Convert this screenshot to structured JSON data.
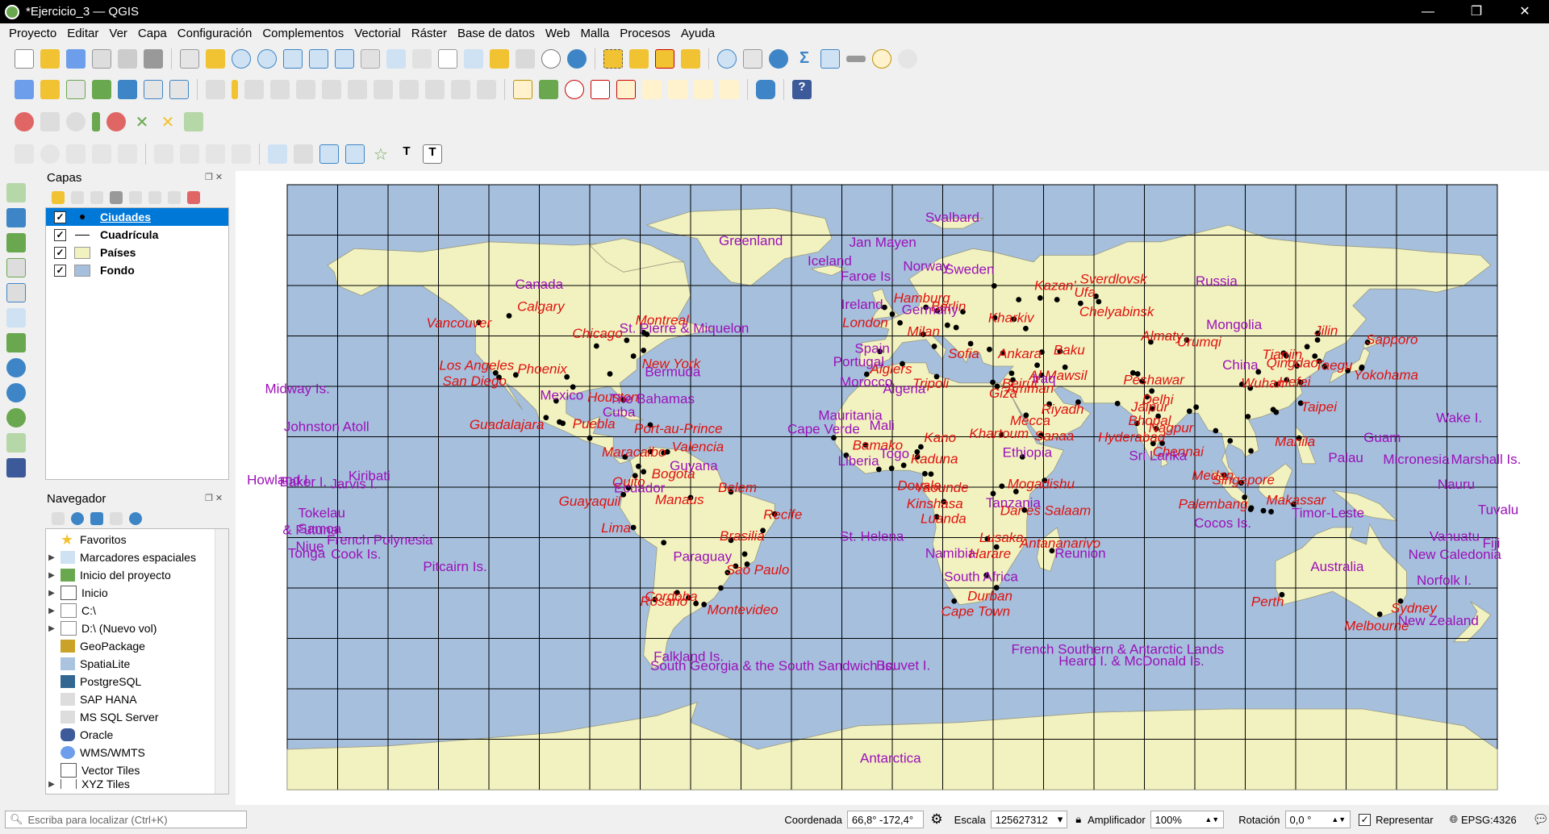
{
  "window": {
    "title": "*Ejercicio_3 — QGIS",
    "controls": [
      "—",
      "❐",
      "✕"
    ]
  },
  "menu": [
    "Proyecto",
    "Editar",
    "Ver",
    "Capa",
    "Configuración",
    "Complementos",
    "Vectorial",
    "Ráster",
    "Base de datos",
    "Web",
    "Malla",
    "Procesos",
    "Ayuda"
  ],
  "layers_panel": {
    "title": "Capas",
    "layers": [
      {
        "name": "Ciudades",
        "checked": true,
        "symbol": "point-icon",
        "selected": true
      },
      {
        "name": "Cuadrícula",
        "checked": true,
        "symbol": "line-icon",
        "selected": false
      },
      {
        "name": "Países",
        "checked": true,
        "symbol": "fill-yellow-icon",
        "selected": false
      },
      {
        "name": "Fondo",
        "checked": true,
        "symbol": "fill-blue-icon",
        "selected": false
      }
    ]
  },
  "browser_panel": {
    "title": "Navegador",
    "items": [
      {
        "label": "Favoritos",
        "icon": "star-icon",
        "expandable": false
      },
      {
        "label": "Marcadores espaciales",
        "icon": "bookmark-icon",
        "expandable": true
      },
      {
        "label": "Inicio del proyecto",
        "icon": "project-home-icon",
        "expandable": true
      },
      {
        "label": "Inicio",
        "icon": "home-icon",
        "expandable": true
      },
      {
        "label": "C:\\",
        "icon": "folder-icon",
        "expandable": true
      },
      {
        "label": "D:\\ (Nuevo vol)",
        "icon": "folder-icon",
        "expandable": true
      },
      {
        "label": "GeoPackage",
        "icon": "geopackage-icon",
        "expandable": false
      },
      {
        "label": "SpatiaLite",
        "icon": "spatialite-icon",
        "expandable": false
      },
      {
        "label": "PostgreSQL",
        "icon": "postgresql-icon",
        "expandable": false
      },
      {
        "label": "SAP HANA",
        "icon": "sap-hana-icon",
        "expandable": false
      },
      {
        "label": "MS SQL Server",
        "icon": "mssql-icon",
        "expandable": false
      },
      {
        "label": "Oracle",
        "icon": "oracle-icon",
        "expandable": false
      },
      {
        "label": "WMS/WMTS",
        "icon": "wms-icon",
        "expandable": false
      },
      {
        "label": "Vector Tiles",
        "icon": "vector-tiles-icon",
        "expandable": false
      },
      {
        "label": "XYZ Tiles",
        "icon": "xyz-tiles-icon",
        "expandable": true
      }
    ]
  },
  "map": {
    "colors": {
      "ocean": "#a5bfdd",
      "land": "#f2f2c0",
      "grid": "#000000",
      "city_label": "#e0110d",
      "country_label": "#9c10b8"
    },
    "city_labels": [
      "Calgary",
      "Vancouver",
      "Chicago",
      "Montreal",
      "Los Angeles",
      "Phoenix",
      "New York",
      "San Diego",
      "Houston",
      "Puebla",
      "Guadalajara",
      "Port-au-Prince",
      "Maracaibo",
      "Valencia",
      "Bogota",
      "Quito",
      "Guayaquil",
      "Belem",
      "Manaus",
      "Recife",
      "Lima",
      "Brasilia",
      "Sao Paulo",
      "Cordoba",
      "Rosario",
      "Montevideo",
      "Hamburg",
      "Berlin",
      "London",
      "Milan",
      "Sofia",
      "Algiers",
      "Tripoli",
      "Kharkiv",
      "Kazan'",
      "Ufa",
      "Sverdlovsk",
      "Chelyabinsk",
      "Ankara",
      "Baku",
      "Beirut",
      "Al Mawsil",
      "Amman",
      "Giza",
      "Mecca",
      "Riyadh",
      "Almaty",
      "Urumqi",
      "Peshawar",
      "Delhi",
      "Jaipur",
      "Bhopal",
      "Nagpur",
      "Hyderabad",
      "Chennai",
      "Tianjin",
      "Jilin",
      "Qingdao",
      "Taegu",
      "Sapporo",
      "Yokohama",
      "Wuhan",
      "Hefei",
      "Taipei",
      "Manila",
      "Kano",
      "Kaduna",
      "Bamako",
      "Douala",
      "Yaounde",
      "Khartoum",
      "Sanaa",
      "Mogadishu",
      "Kinshasa",
      "Dar es Salaam",
      "Luanda",
      "Lusaka",
      "Antananarivo",
      "Harare",
      "Durban",
      "Cape Town",
      "Medan",
      "Singapore",
      "Palembang",
      "Makassar",
      "Perth",
      "Melbourne",
      "Sydney"
    ],
    "country_labels": [
      "Greenland",
      "Svalbard",
      "Jan Mayen",
      "Iceland",
      "Norway",
      "Sweden",
      "Faroe Is.",
      "Canada",
      "Ireland",
      "Germany",
      "Russia",
      "Mongolia",
      "China",
      "Spain",
      "Portugal",
      "St. Pierre & Miquelon",
      "Bermuda",
      "Morocco",
      "Algeria",
      "Iraq",
      "Mexico",
      "The Bahamas",
      "Cuba",
      "Mauritania",
      "Mali",
      "Cape Verde",
      "Togo",
      "Ethiopia",
      "Sri Lanka",
      "Liberia",
      "Guyana",
      "Ecuador",
      "Tanzania",
      "Namibia",
      "South Africa",
      "St. Helena",
      "Paraguay",
      "Midway Is.",
      "Johnston Atoll",
      "Howland I.",
      "Baker I.",
      "Kiribati",
      "Jarvis I.",
      "Tokelau",
      "Samoa",
      "French Polynesia",
      "& Futuna",
      "Tonga",
      "Niue",
      "Cook Is.",
      "Pitcairn Is.",
      "Reunion",
      "Cocos Is.",
      "Timor-Leste",
      "Guam",
      "Palau",
      "Micronesia",
      "Wake I.",
      "Marshall Is.",
      "Nauru",
      "Tuvalu",
      "Vanuatu",
      "Fiji",
      "New Caledonia",
      "Norfolk I.",
      "Australia",
      "New Zealand",
      "Falkland Is.",
      "South Georgia & the South Sandwich Is.",
      "Bouvet I.",
      "French Southern & Antarctic Lands",
      "Heard I. & McDonald Is.",
      "Antarctica"
    ]
  },
  "statusbar": {
    "locate_placeholder": "Escriba para localizar (Ctrl+K)",
    "coordinate_label": "Coordenada",
    "coordinate_value": "66,8° -172,4°",
    "scale_label": "Escala",
    "scale_value": "125627312",
    "magnifier_label": "Amplificador",
    "magnifier_value": "100%",
    "rotation_label": "Rotación",
    "rotation_value": "0,0 °",
    "render_label": "Representar",
    "render_checked": true,
    "crs": "EPSG:4326"
  }
}
